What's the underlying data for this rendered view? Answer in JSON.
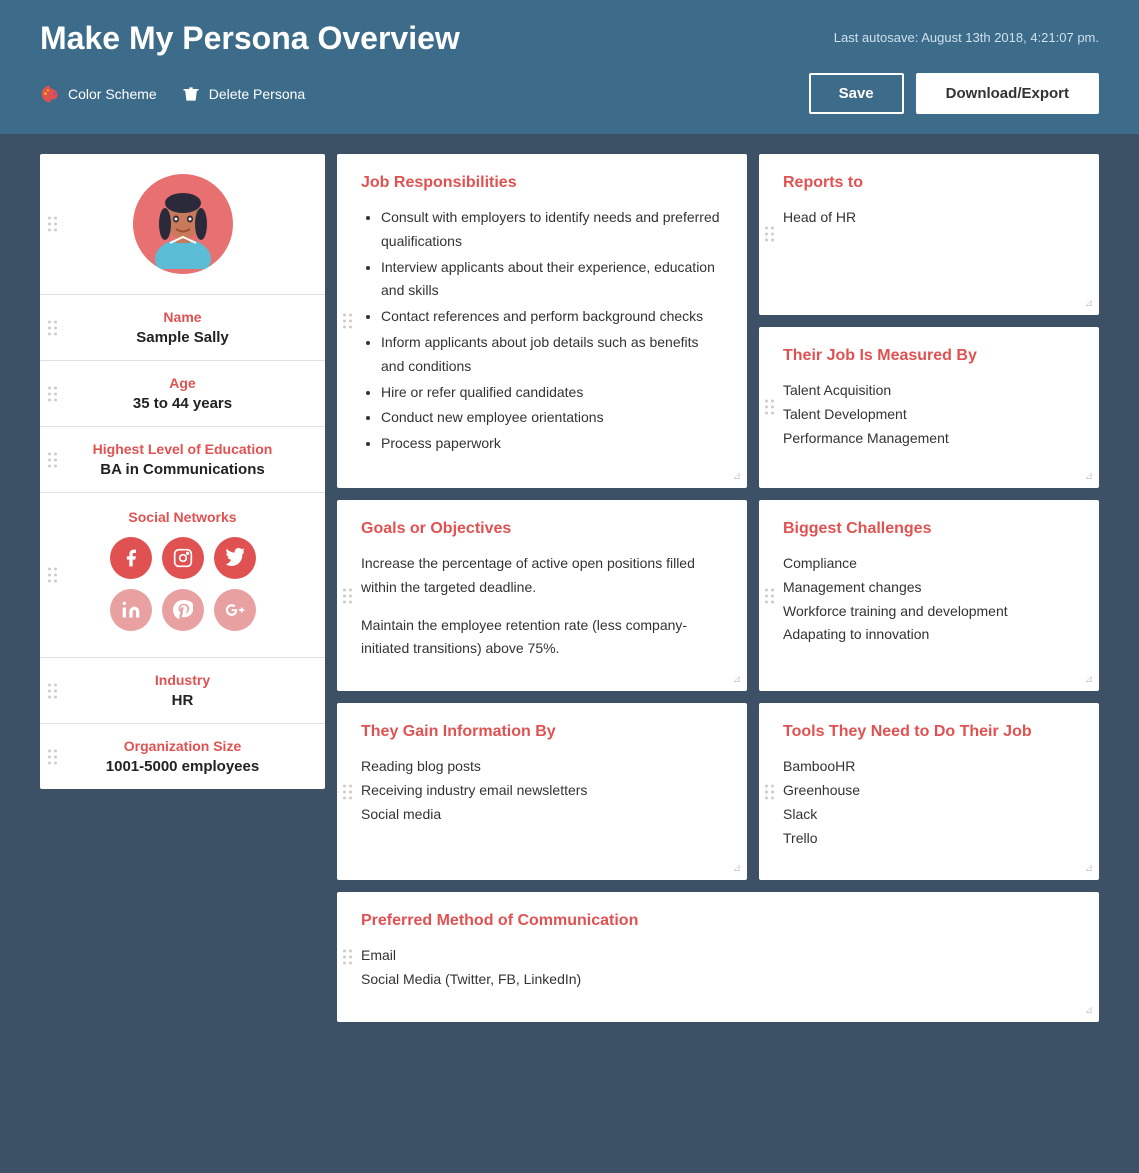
{
  "header": {
    "title": "Make My Persona Overview",
    "autosave": "Last autosave: August 13th 2018, 4:21:07 pm.",
    "color_scheme_label": "Color Scheme",
    "delete_persona_label": "Delete Persona",
    "save_label": "Save",
    "download_label": "Download/Export"
  },
  "sidebar": {
    "name_label": "Name",
    "name_value": "Sample Sally",
    "age_label": "Age",
    "age_value": "35 to 44 years",
    "education_label": "Highest Level of Education",
    "education_value": "BA in Communications",
    "social_label": "Social Networks",
    "industry_label": "Industry",
    "industry_value": "HR",
    "org_size_label": "Organization Size",
    "org_size_value": "1001-5000 employees"
  },
  "cards": {
    "job_responsibilities": {
      "title": "Job Responsibilities",
      "items": [
        "Consult with employers to identify needs and preferred qualifications",
        "Interview applicants about their experience, education and skills",
        "Contact references and perform background checks",
        "Inform applicants about job details such as benefits and conditions",
        "Hire or refer qualified candidates",
        "Conduct new employee orientations",
        "Process paperwork"
      ]
    },
    "reports_to": {
      "title": "Reports to",
      "value": "Head of HR"
    },
    "measured_by": {
      "title": "Their Job Is Measured By",
      "items": [
        "Talent Acquisition",
        "Talent Development",
        "Performance Management"
      ]
    },
    "goals": {
      "title": "Goals or Objectives",
      "text1": "Increase the percentage of active open positions filled within the targeted deadline.",
      "text2": "Maintain the employee retention rate (less company-initiated transitions) above 75%."
    },
    "challenges": {
      "title": "Biggest Challenges",
      "items": [
        "Compliance",
        "Management changes",
        "Workforce training and development",
        "Adapating to innovation"
      ]
    },
    "gain_info": {
      "title": "They Gain Information By",
      "items": [
        "Reading blog posts",
        "Receiving industry email newsletters",
        "Social media"
      ]
    },
    "tools": {
      "title": "Tools They Need to Do Their Job",
      "items": [
        "BambooHR",
        "Greenhouse",
        "Slack",
        "Trello"
      ]
    },
    "communication": {
      "title": "Preferred Method of Communication",
      "items": [
        "Email",
        "Social Media (Twitter, FB, LinkedIn)"
      ]
    }
  },
  "social_icons": {
    "facebook": "f",
    "instagram": "📷",
    "twitter": "🐦",
    "linkedin": "in",
    "pinterest": "P",
    "google": "g+"
  }
}
